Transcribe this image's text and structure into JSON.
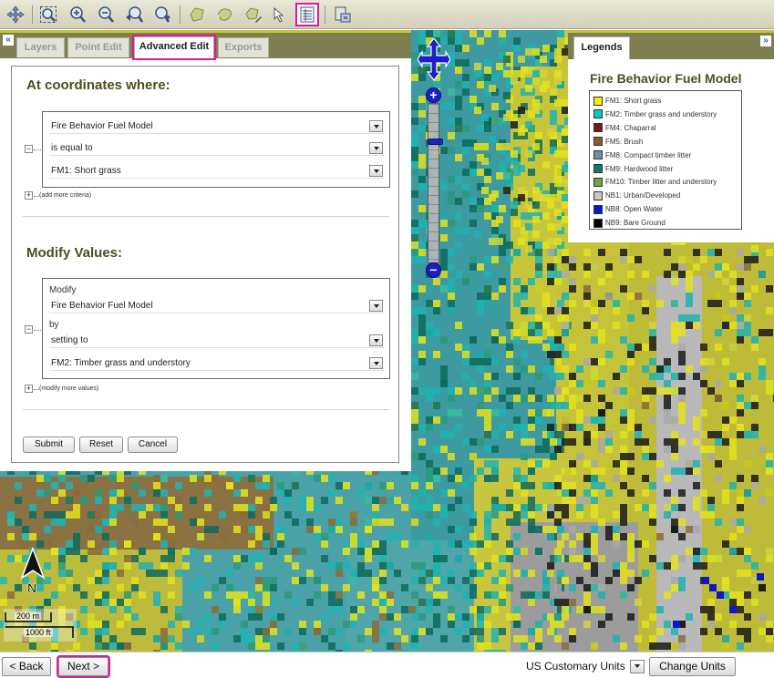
{
  "toolbar": {
    "tools": [
      {
        "name": "pan-tool",
        "icon": "pan-icon"
      },
      {
        "name": "zoom-extent-tool",
        "icon": "zoom-extent-icon"
      },
      {
        "name": "zoom-in-tool",
        "icon": "zoom-in-icon"
      },
      {
        "name": "zoom-out-tool",
        "icon": "zoom-out-icon"
      },
      {
        "name": "zoom-previous-tool",
        "icon": "zoom-previous-icon"
      },
      {
        "name": "zoom-next-tool",
        "icon": "zoom-next-icon"
      },
      {
        "name": "draw-polygon-tool",
        "icon": "polygon-icon"
      },
      {
        "name": "draw-freehand-tool",
        "icon": "freehand-icon"
      },
      {
        "name": "edit-polygon-tool",
        "icon": "edit-polygon-icon"
      },
      {
        "name": "select-tool",
        "icon": "arrow-icon"
      },
      {
        "name": "attribute-table-tool",
        "icon": "table-icon",
        "selected": true
      },
      {
        "name": "export-tool",
        "icon": "export-icon"
      }
    ]
  },
  "left_panel": {
    "tabs": [
      {
        "label": "Layers",
        "active": false
      },
      {
        "label": "Point Edit",
        "active": false
      },
      {
        "label": "Advanced Edit",
        "active": true
      },
      {
        "label": "Exports",
        "active": false
      }
    ],
    "criteria": {
      "heading": "At coordinates where:",
      "field": "Fire Behavior Fuel Model",
      "operator": "is equal to",
      "value": "FM1: Short grass",
      "add_more": "(add more criteria)"
    },
    "modify": {
      "heading": "Modify Values:",
      "modify_label": "Modify",
      "field": "Fire Behavior Fuel Model",
      "by_label": "by",
      "method": "setting to",
      "value": "FM2: Timber grass and understory",
      "add_more": "(modify more values)"
    },
    "buttons": {
      "submit": "Submit",
      "reset": "Reset",
      "cancel": "Cancel"
    }
  },
  "legend": {
    "tab": "Legends",
    "title": "Fire Behavior Fuel Model",
    "items": [
      {
        "label": "FM1: Short grass",
        "color": "#f2f200"
      },
      {
        "label": "FM2: Timber grass and understory",
        "color": "#00c9c9"
      },
      {
        "label": "FM4: Chaparral",
        "color": "#7a1a10"
      },
      {
        "label": "FM5: Brush",
        "color": "#8c5a2b"
      },
      {
        "label": "FM8: Compact timber litter",
        "color": "#6d8fb0"
      },
      {
        "label": "FM9: Hardwood litter",
        "color": "#0e7a6a"
      },
      {
        "label": "FM10: Timber litter and understory",
        "color": "#6ea64a"
      },
      {
        "label": "NB1: Urban/Developed",
        "color": "#c8c8c8"
      },
      {
        "label": "NB8: Open Water",
        "color": "#0a14d8"
      },
      {
        "label": "NB9: Bare Ground",
        "color": "#000000"
      }
    ]
  },
  "map": {
    "north_label": "N",
    "scale_metric": "200 m",
    "scale_imperial": "1000 ft"
  },
  "bottom": {
    "back": "< Back",
    "next": "Next >",
    "units": "US Customary Units",
    "change_units": "Change Units"
  }
}
